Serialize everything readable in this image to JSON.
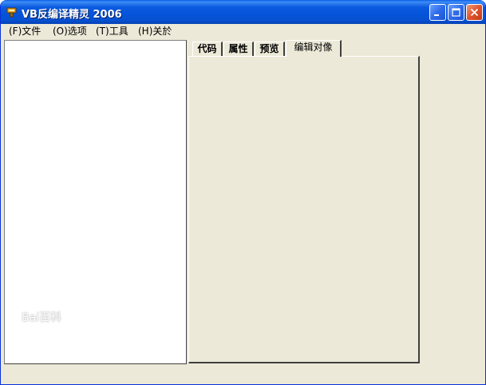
{
  "window": {
    "title": "VB反编译精灵 2006",
    "colors": {
      "titlebar": "#0553d8",
      "close_button": "#e0532c",
      "face": "#ece9d8"
    }
  },
  "titlebar_buttons": {
    "minimize_icon": "minimize-icon",
    "maximize_icon": "maximize-icon",
    "close_icon": "close-icon"
  },
  "menu": {
    "items": [
      {
        "label": "(F)文件"
      },
      {
        "label": "(O)选项"
      },
      {
        "label": "(T)工具"
      },
      {
        "label": "(H)关於"
      }
    ]
  },
  "tabs": [
    {
      "label": "代码",
      "active": false
    },
    {
      "label": "属性",
      "active": false
    },
    {
      "label": "预览",
      "active": false
    },
    {
      "label": "编辑对像",
      "active": true
    }
  ],
  "watermark": {
    "text": "Bai百科"
  }
}
